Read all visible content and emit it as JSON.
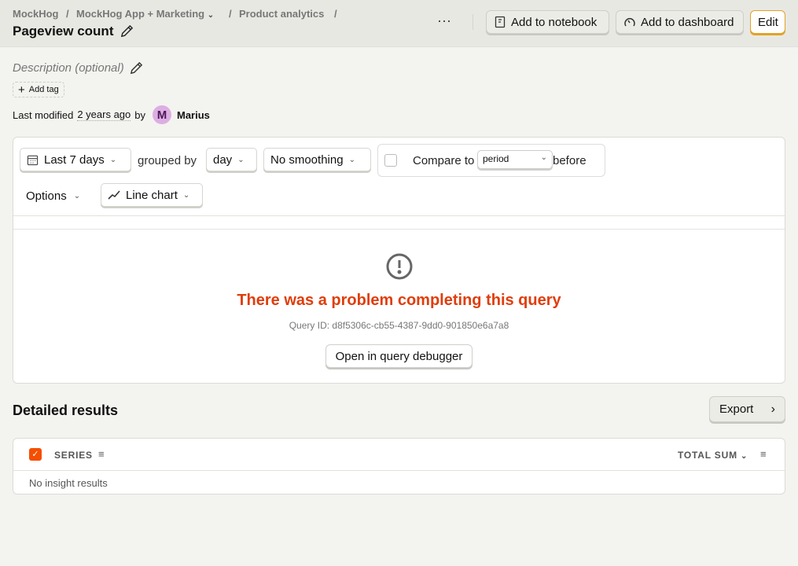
{
  "breadcrumb": {
    "org": "MockHog",
    "project": "MockHog App + Marketing",
    "section": "Product analytics",
    "sep": "/"
  },
  "title": "Pageview count",
  "header_actions": {
    "more": "⋯",
    "notebook": "Add to notebook",
    "dashboard": "Add to dashboard",
    "edit": "Edit"
  },
  "description_placeholder": "Description (optional)",
  "add_tag": "Add tag",
  "modified": {
    "prefix": "Last modified",
    "when": "2 years ago",
    "by": "by",
    "avatar_letter": "M",
    "user": "Marius"
  },
  "filters": {
    "date_range": "Last 7 days",
    "grouped_by": "grouped by",
    "interval": "day",
    "smoothing": "No smoothing",
    "compare_to": "Compare to",
    "compare_period": "period",
    "before": "before",
    "options": "Options",
    "chart_type": "Line chart",
    "compare_checked": false
  },
  "error": {
    "title": "There was a problem completing this query",
    "query_id": "Query ID: d8f5306c-cb55-4387-9dd0-901850e6a7a8",
    "debugger": "Open in query debugger"
  },
  "results": {
    "heading": "Detailed results",
    "export": "Export",
    "col_series": "SERIES",
    "col_total": "TOTAL SUM",
    "empty": "No insight results"
  },
  "colors": {
    "accent": "#f54e00",
    "error": "#e03d0b",
    "edit_border": "#e3a226",
    "avatar": "#dcaee3"
  }
}
